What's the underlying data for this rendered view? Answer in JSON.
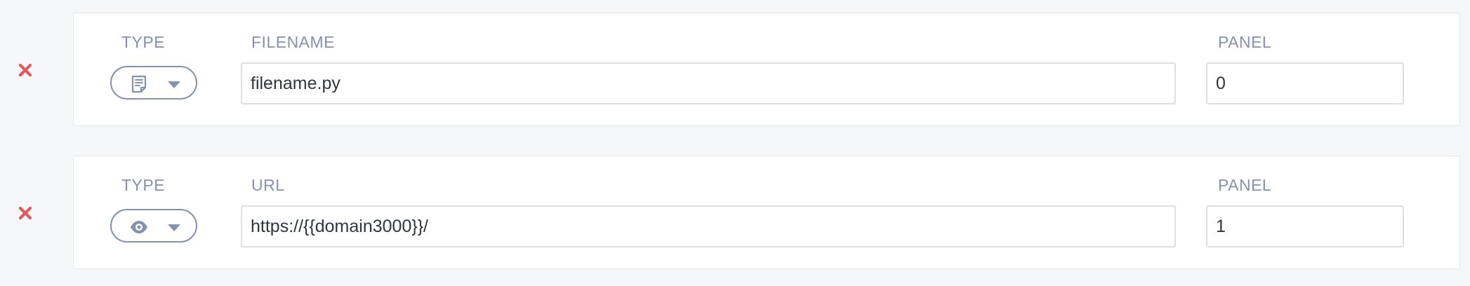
{
  "colors": {
    "label": "#8592ad",
    "remove": "#e0595c",
    "border": "#dcdfe5",
    "icon": "#8592ad"
  },
  "rows": [
    {
      "remove_icon": "close-x-icon",
      "type_label": "TYPE",
      "type_icon": "file-icon",
      "chevron_icon": "chevron-down-icon",
      "field_label": "FILENAME",
      "field_value": "filename.py",
      "panel_label": "PANEL",
      "panel_value": "0"
    },
    {
      "remove_icon": "close-x-icon",
      "type_label": "TYPE",
      "type_icon": "eye-icon",
      "chevron_icon": "chevron-down-icon",
      "field_label": "URL",
      "field_value": "https://{{domain3000}}/",
      "panel_label": "PANEL",
      "panel_value": "1"
    }
  ]
}
